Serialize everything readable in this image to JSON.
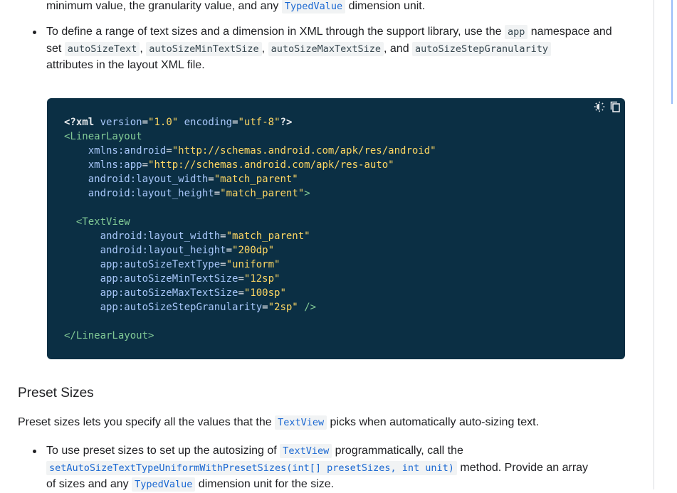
{
  "para_top": {
    "text_before": "minimum value, the granularity value, and any ",
    "code": "TypedValue",
    "text_after": " dimension unit."
  },
  "bullet1": {
    "t1": "To define a range of text sizes and a dimension in XML through the support library, use the ",
    "c1": "app",
    "t2": " namespace and",
    "t3": "set ",
    "c2": "autoSizeText",
    "t4": ", ",
    "c3": "autoSizeMinTextSize",
    "t5": ", ",
    "c4": "autoSizeMaxTextSize",
    "t6": ", and ",
    "c5": "autoSizeStepGranularity",
    "t7": "attributes in the layout XML file."
  },
  "code_block": {
    "lines": [
      [
        {
          "c": "kw",
          "t": "<?xml "
        },
        {
          "c": "attr",
          "t": "version"
        },
        {
          "c": "plain",
          "t": "="
        },
        {
          "c": "val",
          "t": "\"1.0\""
        },
        {
          "c": "plain",
          "t": " "
        },
        {
          "c": "attr",
          "t": "encoding"
        },
        {
          "c": "plain",
          "t": "="
        },
        {
          "c": "val",
          "t": "\"utf-8\""
        },
        {
          "c": "kw",
          "t": "?>"
        }
      ],
      [
        {
          "c": "tag",
          "t": "<LinearLayout"
        }
      ],
      [
        {
          "c": "plain",
          "t": "    "
        },
        {
          "c": "attr",
          "t": "xmlns:android"
        },
        {
          "c": "plain",
          "t": "="
        },
        {
          "c": "val",
          "t": "\"http://schemas.android.com/apk/res/android\""
        }
      ],
      [
        {
          "c": "plain",
          "t": "    "
        },
        {
          "c": "attr",
          "t": "xmlns:app"
        },
        {
          "c": "plain",
          "t": "="
        },
        {
          "c": "val",
          "t": "\"http://schemas.android.com/apk/res-auto\""
        }
      ],
      [
        {
          "c": "plain",
          "t": "    "
        },
        {
          "c": "attr",
          "t": "android:layout_width"
        },
        {
          "c": "plain",
          "t": "="
        },
        {
          "c": "val",
          "t": "\"match_parent\""
        }
      ],
      [
        {
          "c": "plain",
          "t": "    "
        },
        {
          "c": "attr",
          "t": "android:layout_height"
        },
        {
          "c": "plain",
          "t": "="
        },
        {
          "c": "val",
          "t": "\"match_parent\""
        },
        {
          "c": "tag",
          "t": ">"
        }
      ],
      [
        {
          "c": "plain",
          "t": " "
        }
      ],
      [
        {
          "c": "plain",
          "t": "  "
        },
        {
          "c": "tag",
          "t": "<TextView"
        }
      ],
      [
        {
          "c": "plain",
          "t": "      "
        },
        {
          "c": "attr",
          "t": "android:layout_width"
        },
        {
          "c": "plain",
          "t": "="
        },
        {
          "c": "val",
          "t": "\"match_parent\""
        }
      ],
      [
        {
          "c": "plain",
          "t": "      "
        },
        {
          "c": "attr",
          "t": "android:layout_height"
        },
        {
          "c": "plain",
          "t": "="
        },
        {
          "c": "val",
          "t": "\"200dp\""
        }
      ],
      [
        {
          "c": "plain",
          "t": "      "
        },
        {
          "c": "attr",
          "t": "app:autoSizeTextType"
        },
        {
          "c": "plain",
          "t": "="
        },
        {
          "c": "val",
          "t": "\"uniform\""
        }
      ],
      [
        {
          "c": "plain",
          "t": "      "
        },
        {
          "c": "attr",
          "t": "app:autoSizeMinTextSize"
        },
        {
          "c": "plain",
          "t": "="
        },
        {
          "c": "val",
          "t": "\"12sp\""
        }
      ],
      [
        {
          "c": "plain",
          "t": "      "
        },
        {
          "c": "attr",
          "t": "app:autoSizeMaxTextSize"
        },
        {
          "c": "plain",
          "t": "="
        },
        {
          "c": "val",
          "t": "\"100sp\""
        }
      ],
      [
        {
          "c": "plain",
          "t": "      "
        },
        {
          "c": "attr",
          "t": "app:autoSizeStepGranularity"
        },
        {
          "c": "plain",
          "t": "="
        },
        {
          "c": "val",
          "t": "\"2sp\""
        },
        {
          "c": "plain",
          "t": " "
        },
        {
          "c": "tag",
          "t": "/>"
        }
      ],
      [
        {
          "c": "plain",
          "t": " "
        }
      ],
      [
        {
          "c": "tag",
          "t": "</LinearLayout>"
        }
      ]
    ],
    "icons": [
      "dark-mode-icon",
      "copy-icon"
    ]
  },
  "section": {
    "heading": "Preset Sizes",
    "intro_before": "Preset sizes lets you specify all the values that the ",
    "intro_code": "TextView",
    "intro_after": " picks when automatically auto-sizing text."
  },
  "bullet2": {
    "t1": "To use preset sizes to set up the autosizing of ",
    "c1": "TextView",
    "t2": " programmatically, call the",
    "c2": "setAutoSizeTextTypeUniformWithPresetSizes(int[] presetSizes, int unit)",
    "t3": " method. Provide an array",
    "t4": "of sizes and any ",
    "c3": "TypedValue",
    "t5": " dimension unit for the size."
  },
  "colors": {
    "code_bg": "#0b2f44",
    "link_code": "#1967d2",
    "inline_code_bg": "#f1f3f4"
  }
}
